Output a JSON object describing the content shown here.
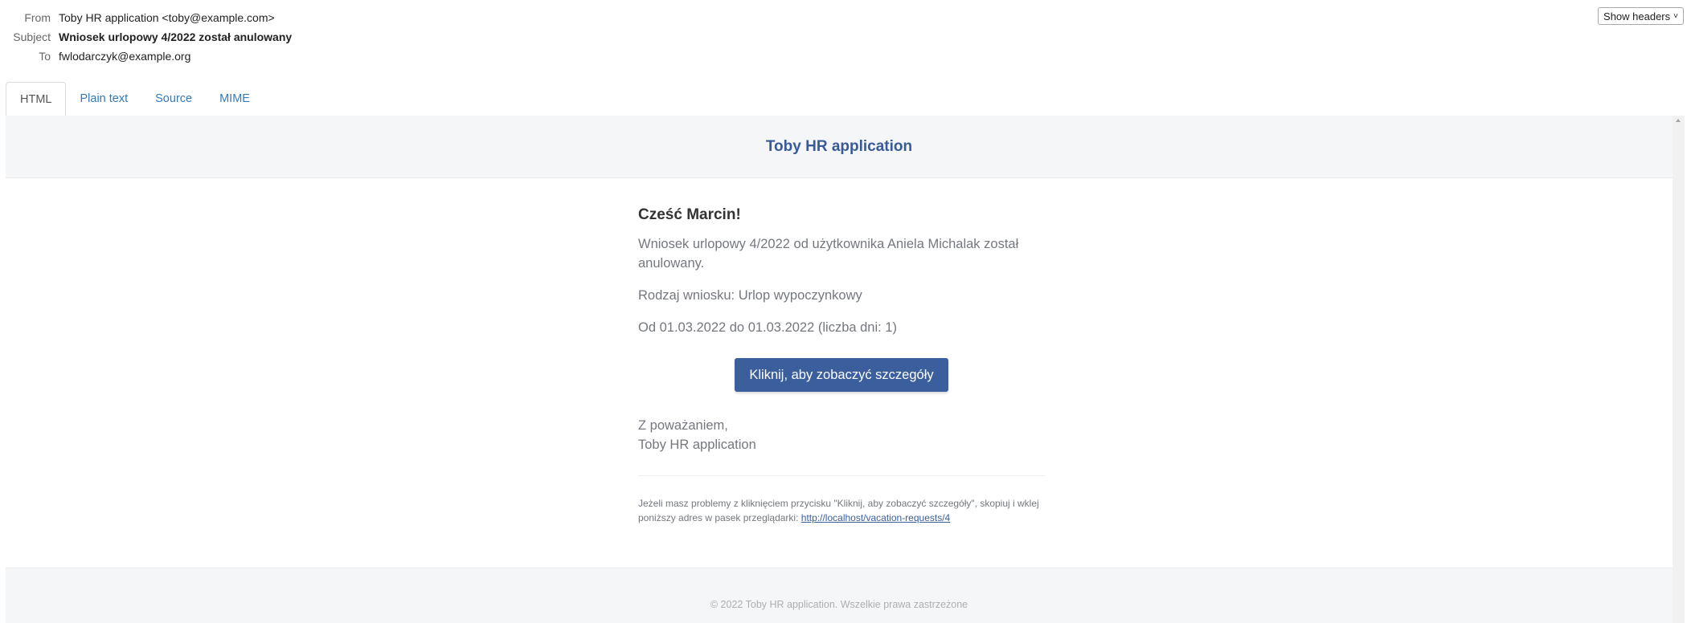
{
  "headers": {
    "from_label": "From",
    "from_value": "Toby HR application <toby@example.com>",
    "subject_label": "Subject",
    "subject_value": "Wniosek urlopowy 4/2022 został anulowany",
    "to_label": "To",
    "to_value": "fwlodarczyk@example.org",
    "show_headers_label": "Show headers"
  },
  "tabs": [
    {
      "label": "HTML",
      "active": true
    },
    {
      "label": "Plain text",
      "active": false
    },
    {
      "label": "Source",
      "active": false
    },
    {
      "label": "MIME",
      "active": false
    }
  ],
  "email": {
    "brand": "Toby HR application",
    "greeting": "Cześć Marcin!",
    "paragraphs": [
      "Wniosek urlopowy 4/2022 od użytkownika Aniela Michalak został anulowany.",
      "Rodzaj wniosku: Urlop wypoczynkowy",
      "Od 01.03.2022 do 01.03.2022 (liczba dni: 1)"
    ],
    "button_label": "Kliknij, aby zobaczyć szczegóły",
    "closing_line1": "Z poważaniem,",
    "closing_line2": "Toby HR application",
    "help_text": "Jeżeli masz problemy z kliknięciem przycisku \"Kliknij, aby zobaczyć szczegóły\", skopiuj i wklej poniższy adres w pasek przeglądarki:",
    "help_link": "http://localhost/vacation-requests/4",
    "copyright": "© 2022 Toby HR application. Wszelkie prawa zastrzeżone"
  },
  "colors": {
    "brand": "#385a97",
    "button": "#3b5e9c",
    "tab_link": "#337ab7"
  }
}
